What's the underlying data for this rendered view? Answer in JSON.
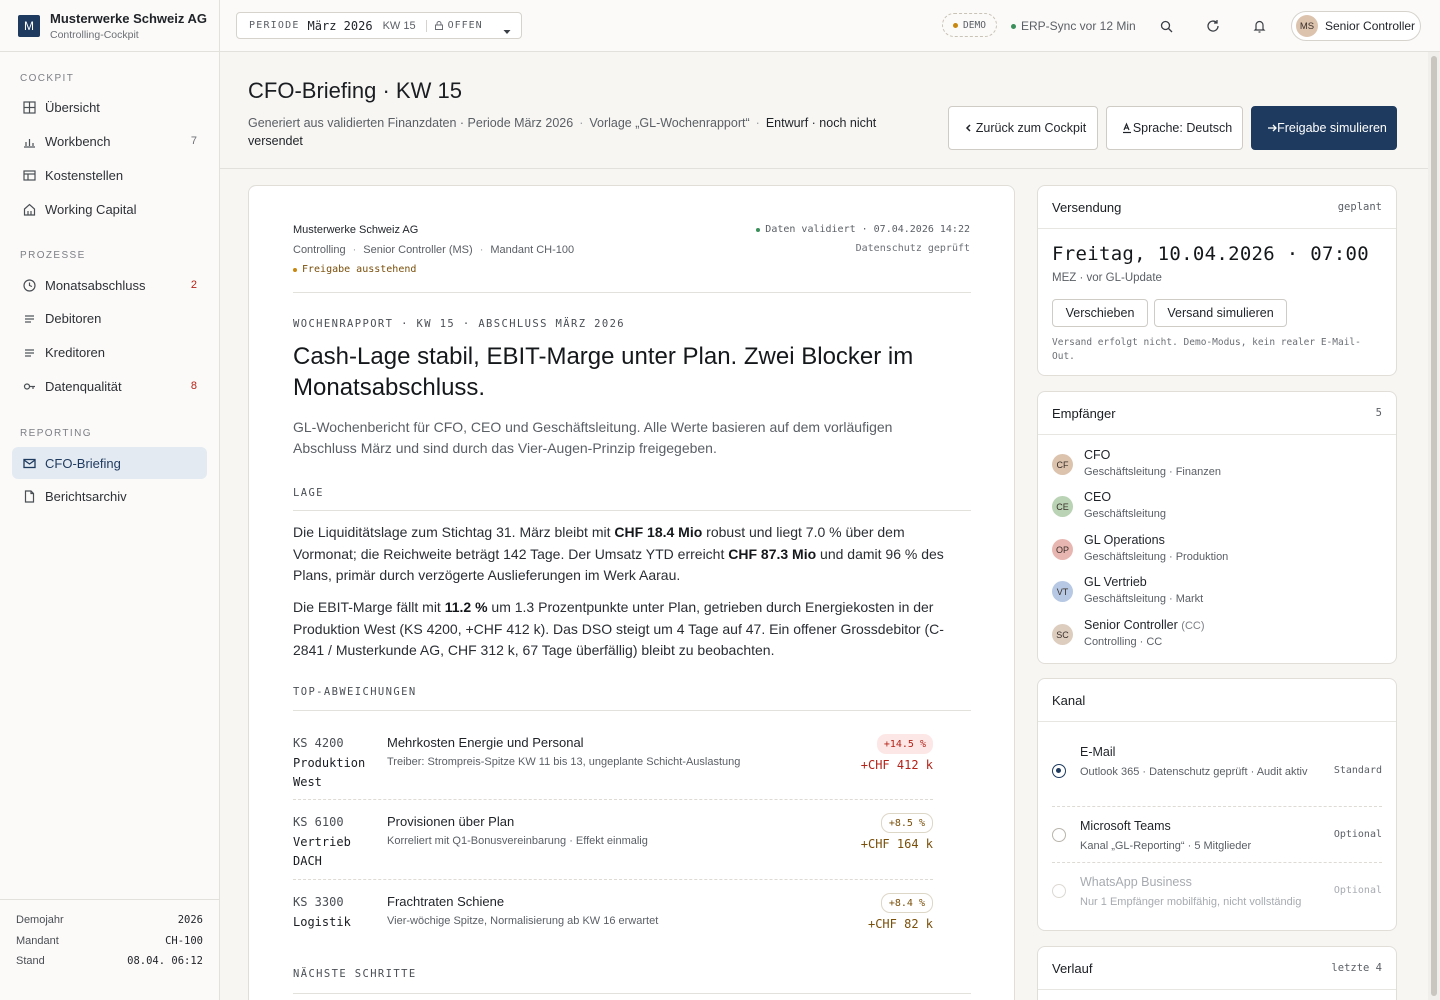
{
  "brand": {
    "logo": "M",
    "name": "Musterwerke Schweiz AG",
    "subtitle": "Controlling-Cockpit"
  },
  "sidebar": {
    "sections": [
      {
        "title": "COCKPIT",
        "items": [
          {
            "label": "Übersicht",
            "icon": "grid-icon",
            "badge": ""
          },
          {
            "label": "Workbench",
            "icon": "bar-chart-icon",
            "badge": "7"
          },
          {
            "label": "Kostenstellen",
            "icon": "table-icon",
            "badge": ""
          },
          {
            "label": "Working Capital",
            "icon": "home-icon",
            "badge": ""
          }
        ]
      },
      {
        "title": "PROZESSE",
        "items": [
          {
            "label": "Monatsabschluss",
            "icon": "clock-icon",
            "badge": "2"
          },
          {
            "label": "Debitoren",
            "icon": "lines-icon",
            "badge": ""
          },
          {
            "label": "Kreditoren",
            "icon": "lines-icon",
            "badge": ""
          },
          {
            "label": "Datenqualität",
            "icon": "key-icon",
            "badge": "8"
          }
        ]
      },
      {
        "title": "REPORTING",
        "items": [
          {
            "label": "CFO-Briefing",
            "icon": "mail-icon",
            "badge": "",
            "active": true
          },
          {
            "label": "Berichtsarchiv",
            "icon": "document-icon",
            "badge": ""
          }
        ]
      }
    ],
    "footer": [
      {
        "label": "Demojahr",
        "value": "2026"
      },
      {
        "label": "Mandant",
        "value": "CH-100"
      },
      {
        "label": "Stand",
        "value": "08.04. 06:12"
      }
    ]
  },
  "topbar": {
    "period_label": "PERIODE",
    "period_value": "März 2026",
    "week": "KW 15",
    "status": "OFFEN",
    "demo": "DEMO",
    "sync": "ERP-Sync vor 12 Min",
    "user_initials": "MS",
    "user_name": "Senior Controller"
  },
  "header": {
    "title": "CFO-Briefing · KW 15",
    "sub_1": "Generiert aus validierten Finanzdaten · Periode März 2026",
    "sub_2": "Vorlage „GL-Wochenrapport“",
    "sub_3": "Entwurf · noch nicht versendet",
    "mid": "·",
    "btn_back": "Zurück zum Cockpit",
    "btn_lang": "Sprache: Deutsch",
    "btn_release": "Freigabe simulieren"
  },
  "report": {
    "company": "Musterwerke Schweiz AG",
    "meta_1": "Controlling",
    "meta_2": "Senior Controller (MS)",
    "meta_3": "Mandant CH-100",
    "pending": "Freigabe ausstehend",
    "validated": "Daten validiert · 07.04.2026 14:22",
    "privacy": "Datenschutz geprüft",
    "kicker": "WOCHENRAPPORT · KW 15 · ABSCHLUSS MÄRZ 2026",
    "headline": "Cash-Lage stabil, EBIT-Marge unter Plan. Zwei Blocker im Monatsabschluss.",
    "lead": "GL-Wochenbericht für CFO, CEO und Geschäftsleitung. Alle Werte basieren auf dem vorläufigen Abschluss März und sind durch das Vier-Augen-Prinzip freigegeben.",
    "section_lage": "LAGE",
    "p1": {
      "t1": "Die Liquiditätslage zum Stichtag 31. März bleibt mit ",
      "b1": "CHF 18.4 Mio",
      "t2": " robust und liegt 7.0 % über dem Vormonat; die Reichweite beträgt 142 Tage. Der Umsatz YTD erreicht ",
      "b2": "CHF 87.3 Mio",
      "t3": " und damit 96 % des Plans, primär durch verzögerte Auslieferungen im Werk Aarau."
    },
    "p2": {
      "t1": "Die EBIT-Marge fällt mit ",
      "b1": "11.2 %",
      "t2": " um 1.3 Prozentpunkte unter Plan, getrieben durch Energiekosten in der Produktion West (KS 4200, +CHF 412 k). Das DSO steigt um 4 Tage auf 47. Ein offener Grossdebitor (C-2841 / Musterkunde AG, CHF 312 k, 67 Tage überfällig) bleibt zu beobachten."
    },
    "section_dev": "TOP-ABWEICHUNGEN",
    "deviations": [
      {
        "ks": "KS 4200",
        "name": "Produktion West",
        "title": "Mehrkosten Energie und Personal",
        "desc": "Treiber: Strompreis-Spitze KW 11 bis 13, ungeplante Schicht-Auslastung",
        "pct": "+14.5 %",
        "amount": "+CHF 412 k",
        "severity": "red"
      },
      {
        "ks": "KS 6100",
        "name": "Vertrieb DACH",
        "title": "Provisionen über Plan",
        "desc": "Korreliert mit Q1-Bonusvereinbarung · Effekt einmalig",
        "pct": "+8.5 %",
        "amount": "+CHF 164 k",
        "severity": "amber"
      },
      {
        "ks": "KS 3300",
        "name": "Logistik",
        "title": "Frachtraten Schiene",
        "desc": "Vier-wöchige Spitze, Normalisierung ab KW 16 erwartet",
        "pct": "+8.4 %",
        "amount": "+CHF 82 k",
        "severity": "amber"
      }
    ],
    "section_next": "NÄCHSTE SCHRITTE"
  },
  "dispatch": {
    "title": "Versendung",
    "status": "geplant",
    "datetime": "Freitag, 10.04.2026 · 07:00",
    "tz": "MEZ · vor GL-Update",
    "btn_move": "Verschieben",
    "btn_sim": "Versand simulieren",
    "note": "Versand erfolgt nicht. Demo-Modus, kein realer E-Mail-Out."
  },
  "recipients": {
    "title": "Empfänger",
    "count": "5",
    "items": [
      {
        "initials": "CF",
        "name": "CFO",
        "cc": "",
        "role": "Geschäftsleitung · Finanzen",
        "color": "#dcc3ae"
      },
      {
        "initials": "CE",
        "name": "CEO",
        "cc": "",
        "role": "Geschäftsleitung",
        "color": "#b9d3b4"
      },
      {
        "initials": "OP",
        "name": "GL Operations",
        "cc": "",
        "role": "Geschäftsleitung · Produktion",
        "color": "#e8b6b0"
      },
      {
        "initials": "VT",
        "name": "GL Vertrieb",
        "cc": "",
        "role": "Geschäftsleitung · Markt",
        "color": "#b6c8e3"
      },
      {
        "initials": "SC",
        "name": "Senior Controller",
        "cc": "(CC)",
        "role": "Controlling · CC",
        "color": "#ddcdbf"
      }
    ]
  },
  "channel": {
    "title": "Kanal",
    "items": [
      {
        "name": "E-Mail",
        "desc": "Outlook 365 · Datenschutz geprüft · Audit aktiv",
        "tag": "Standard",
        "selected": true,
        "disabled": false
      },
      {
        "name": "Microsoft Teams",
        "desc": "Kanal „GL-Reporting“ · 5 Mitglieder",
        "tag": "Optional",
        "selected": false,
        "disabled": false
      },
      {
        "name": "WhatsApp Business",
        "desc": "Nur 1 Empfänger mobilfähig, nicht vollständig",
        "tag": "Optional",
        "selected": false,
        "disabled": true
      }
    ]
  },
  "history": {
    "title": "Verlauf",
    "meta": "letzte 4"
  },
  "colors": {
    "primary": "#1e3a5f",
    "danger": "#b42318",
    "warning": "#7a4f0a",
    "success": "#3b8f5a",
    "amber_dot": "#c8870f"
  }
}
